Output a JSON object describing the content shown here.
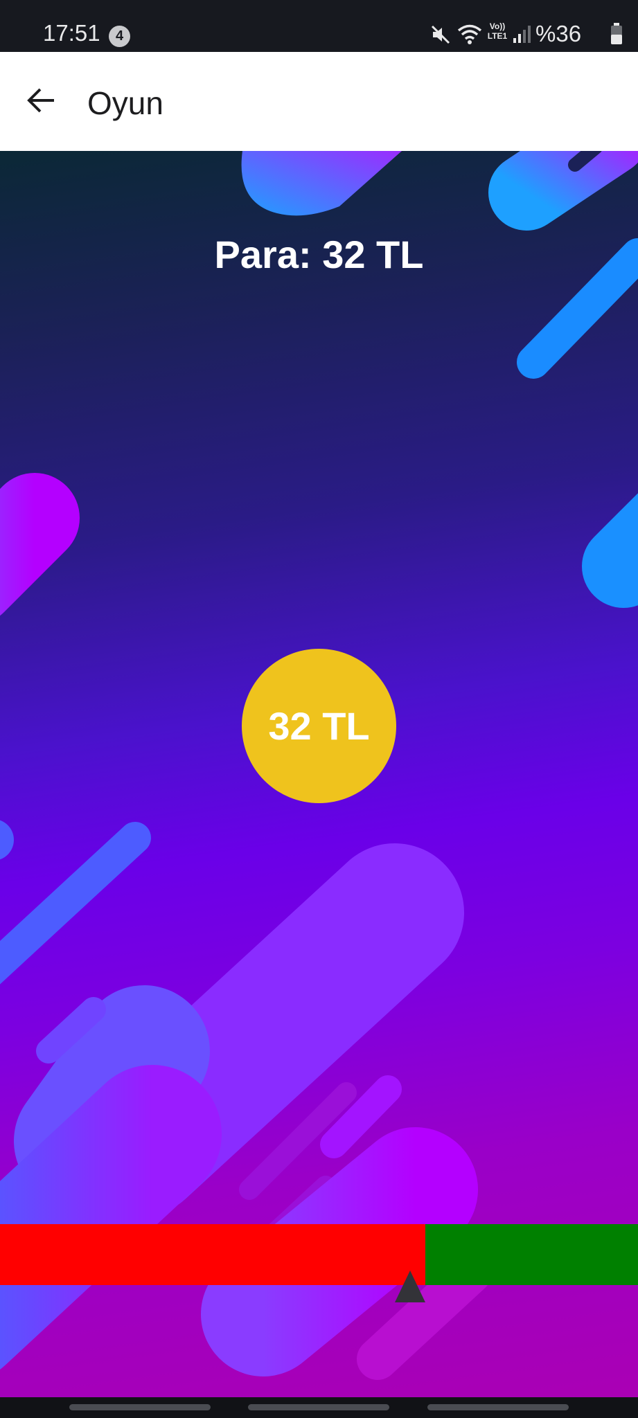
{
  "status_bar": {
    "time": "17:51",
    "notification_count": "4",
    "battery_percent": "%36",
    "lte_label": "LTE1",
    "volte_label": "Vo))",
    "icons": [
      "mute-icon",
      "wifi-icon",
      "volte-lte-icon",
      "signal-icon",
      "battery-icon"
    ]
  },
  "app_bar": {
    "title": "Oyun",
    "back_icon": "arrow-left-icon"
  },
  "game": {
    "money_label": "Para: 32 TL",
    "coin_value": "32 TL",
    "bar_colors": {
      "left": "#ff0000",
      "right": "#008000"
    },
    "coin_color": "#efc31d",
    "pointer_icon": "triangle-up-icon"
  }
}
